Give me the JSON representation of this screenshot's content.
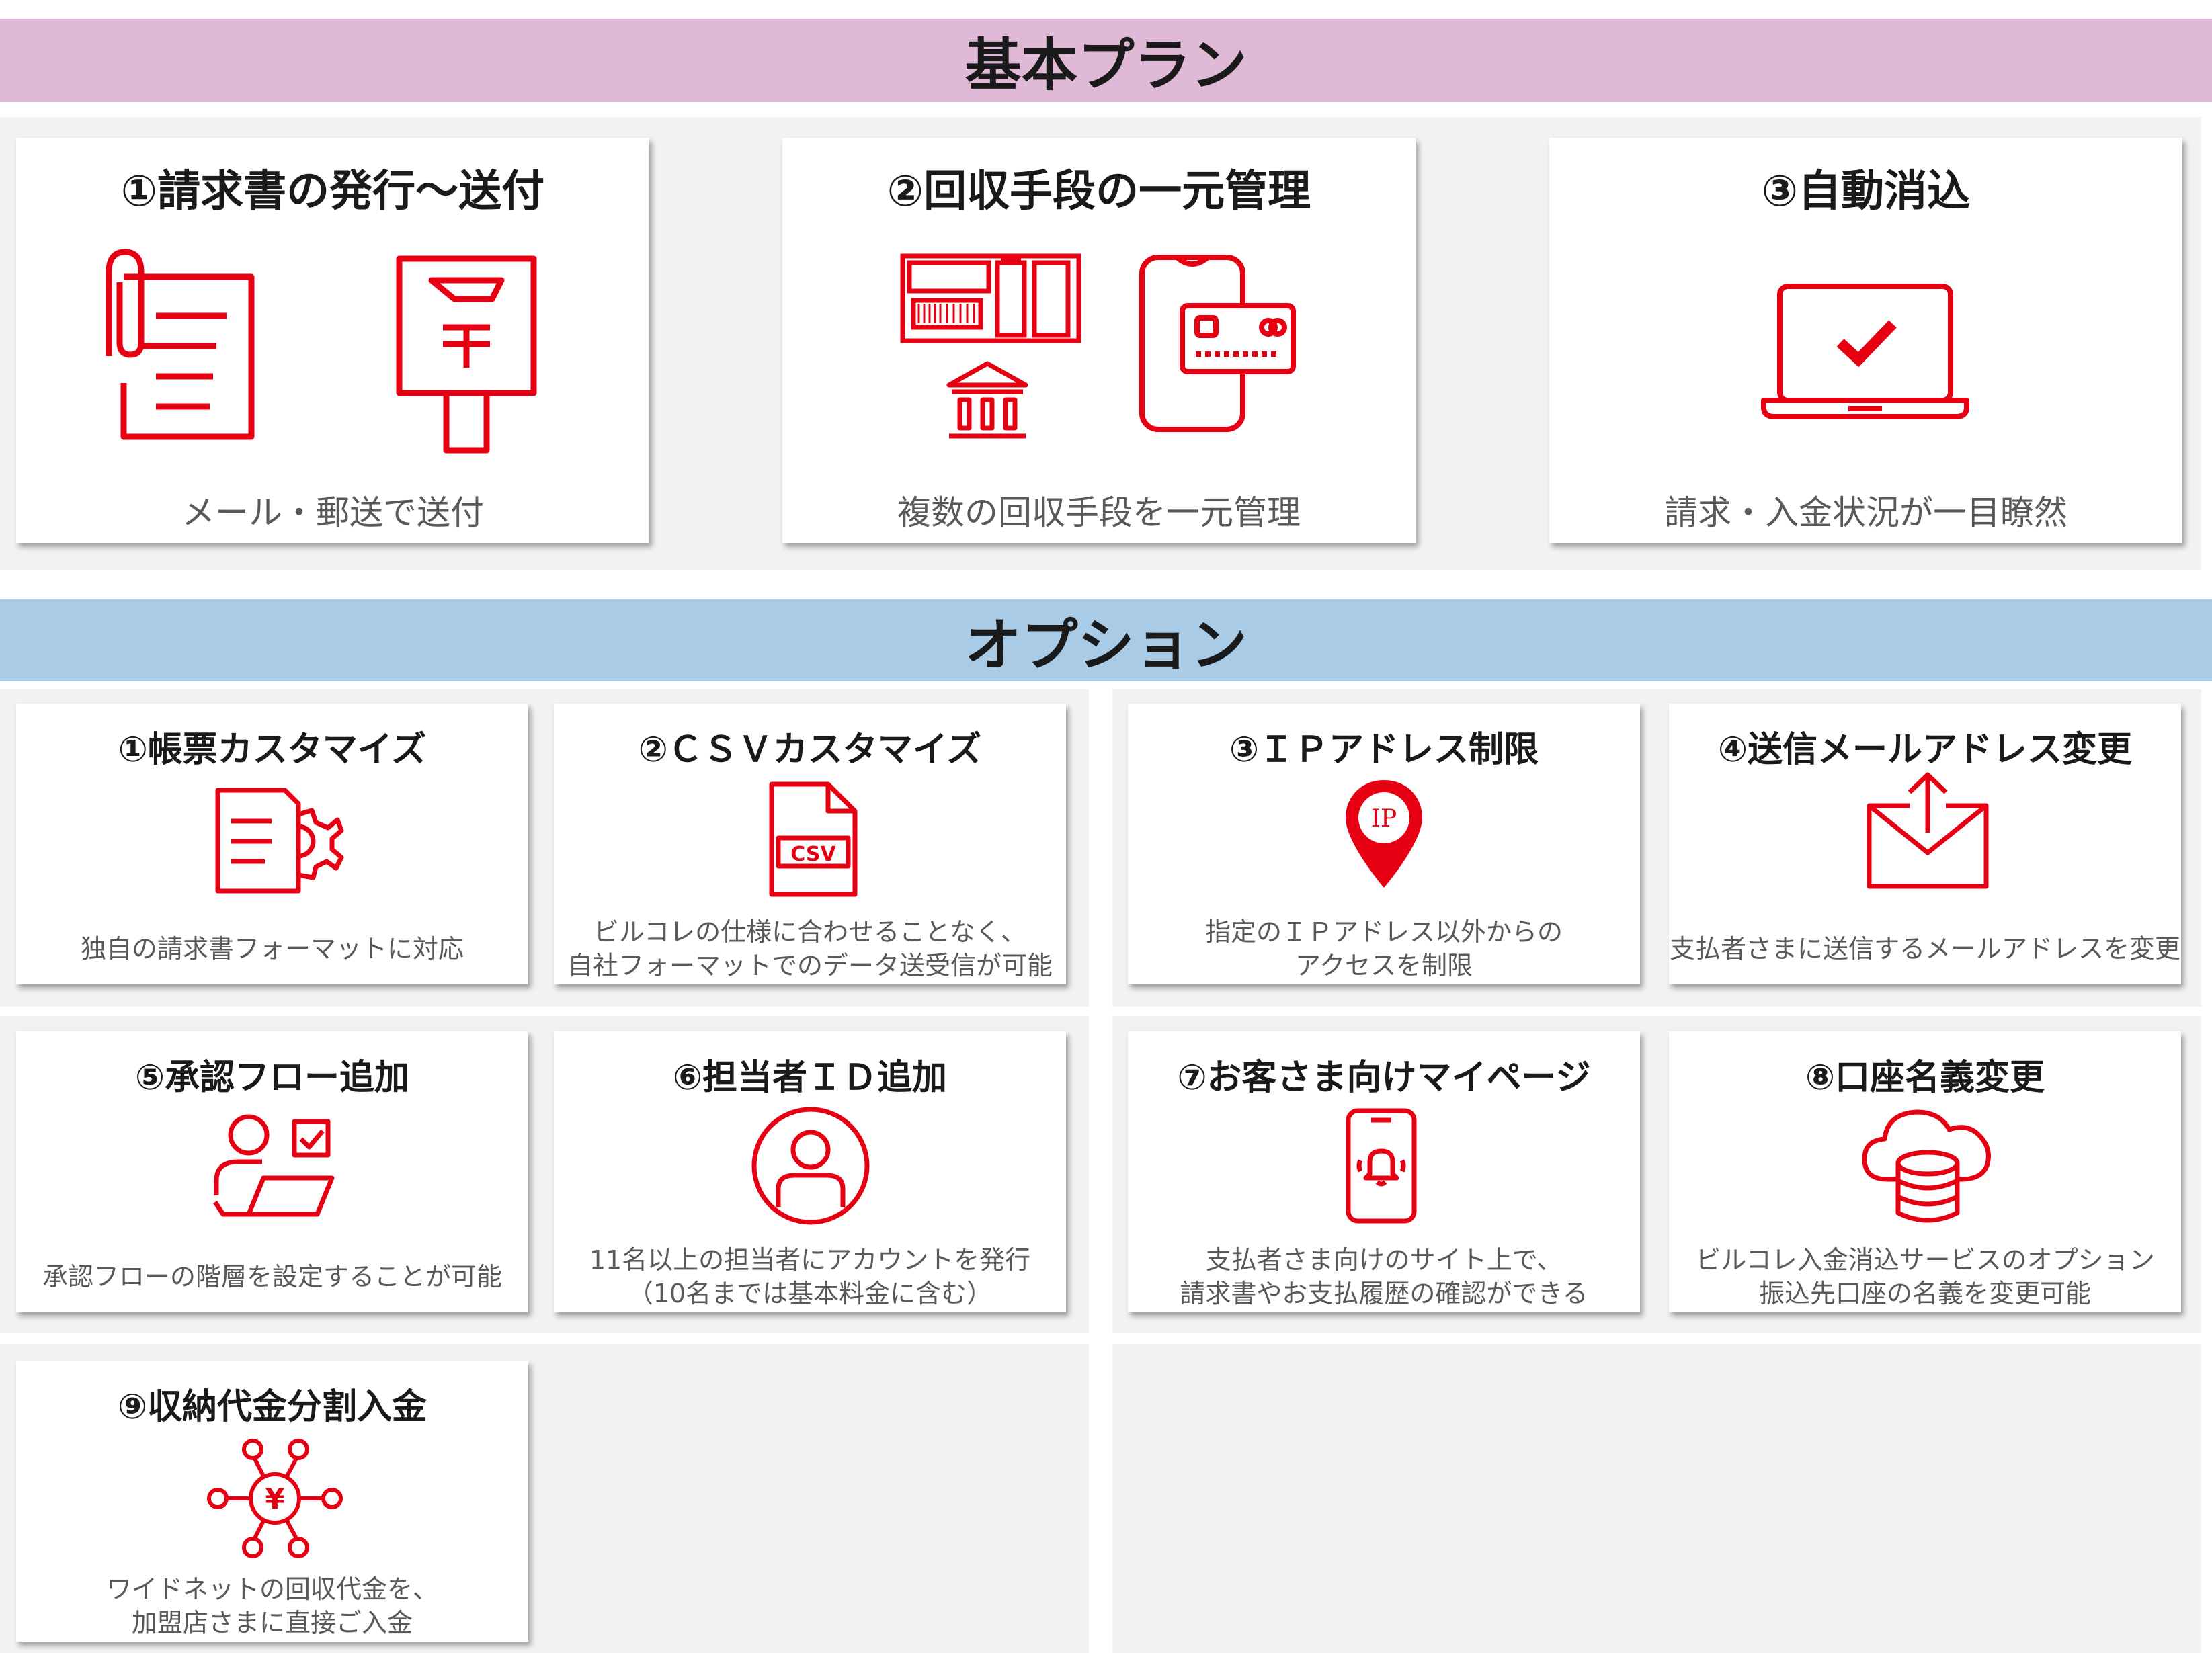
{
  "basic": {
    "heading": "基本プラン",
    "cards": [
      {
        "title": "①請求書の発行～送付",
        "desc": "メール・郵送で送付",
        "icons": [
          "paperclip-document-icon",
          "postbox-icon"
        ]
      },
      {
        "title": "②回収手段の一元管理",
        "desc": "複数の回収手段を一元管理",
        "icons": [
          "payment-slip-icon",
          "bank-icon",
          "smartphone-card-icon"
        ]
      },
      {
        "title": "③自動消込",
        "desc": "請求・入金状況が一目瞭然",
        "icons": [
          "laptop-check-icon"
        ]
      }
    ]
  },
  "options": {
    "heading": "オプション",
    "cards": [
      {
        "title": "①帳票カスタマイズ",
        "desc": [
          "独自の請求書フォーマットに対応"
        ],
        "icon": "document-gear-icon"
      },
      {
        "title": "②ＣＳＶカスタマイズ",
        "desc": [
          "ビルコレの仕様に合わせることなく、",
          "自社フォーマットでのデータ送受信が可能"
        ],
        "icon": "csv-file-icon",
        "icon_text": "CSV"
      },
      {
        "title": "③ＩＰアドレス制限",
        "desc": [
          "指定のＩＰアドレス以外からの",
          "アクセスを制限"
        ],
        "icon": "ip-location-pin-icon",
        "icon_text": "IP"
      },
      {
        "title": "④送信メールアドレス変更",
        "desc": [
          "支払者さまに送信するメールアドレスを変更"
        ],
        "icon": "mail-send-icon"
      },
      {
        "title": "⑤承認フロー追加",
        "desc": [
          "承認フローの階層を設定することが可能"
        ],
        "icon": "user-laptop-approval-icon"
      },
      {
        "title": "⑥担当者ＩＤ追加",
        "desc": [
          "11名以上の担当者にアカウントを発行",
          "（10名までは基本料金に含む）"
        ],
        "icon": "user-circle-icon"
      },
      {
        "title": "⑦お客さま向けマイページ",
        "desc": [
          "支払者さま向けのサイト上で、",
          "請求書やお支払履歴の確認ができる"
        ],
        "icon": "smartphone-bell-icon"
      },
      {
        "title": "⑧口座名義変更",
        "desc": [
          "ビルコレ入金消込サービスのオプション",
          "振込先口座の名義を変更可能"
        ],
        "icon": "cloud-database-icon"
      },
      {
        "title": "⑨収納代金分割入金",
        "desc": [
          "ワイドネットの回収代金を、",
          "加盟店さまに直接ご入金"
        ],
        "icon": "yen-network-icon",
        "icon_text": "¥"
      }
    ]
  },
  "colors": {
    "accent": "#e60012",
    "plan_band": "#dfb9d6",
    "option_band": "#a9cbe6",
    "panel": "#f2f2f2"
  }
}
